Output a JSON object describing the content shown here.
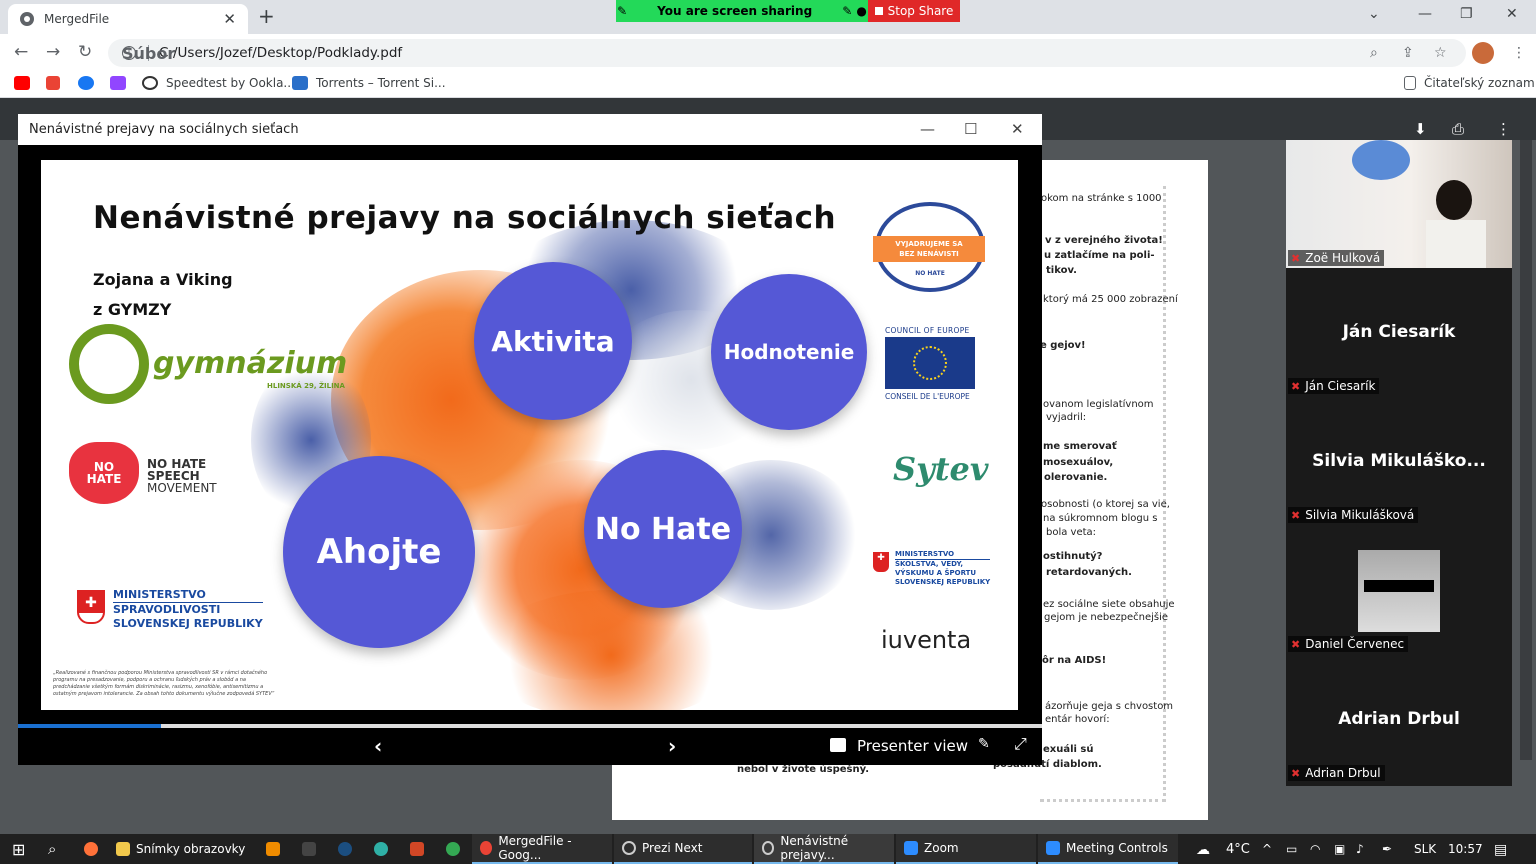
{
  "browser": {
    "tab_title": "MergedFile",
    "new_tab": "+",
    "address_prefix": "Súbor",
    "address": "C:/Users/Jozef/Desktop/Podklady.pdf",
    "bookmarks": [
      "Speedtest by Ookla...",
      "Torrents – Torrent Si..."
    ],
    "reading_list": "Čitateľský zoznam"
  },
  "screen_share": {
    "status": "You are screen sharing",
    "stop_label": "Stop Share"
  },
  "prezi": {
    "window_title": "Nenávistné prejavy na sociálnych sieťach",
    "slide": {
      "title": "Nenávistné prejavy na sociálnych sieťach",
      "authors_line1": "Zojana a Viking",
      "authors_line2": "z GYMZY",
      "school_name": "gymnázium",
      "school_addr": "HLINSKÁ 29, ŽILINA",
      "circles": [
        "Aktivita",
        "Hodnotenie",
        "Ahojte",
        "No Hate"
      ],
      "nohate_badge": "NO HATE",
      "nohate_movement": [
        "NO HATE",
        "SPEECH",
        "MOVEMENT"
      ],
      "vyjadrujeme": [
        "VYJADRUJEME SA",
        "BEZ NENÁVISTI",
        "NO HATE"
      ],
      "coe_top": "COUNCIL OF EUROPE",
      "coe_bottom": "CONSEIL DE L'EUROPE",
      "sytev": "Sytev",
      "min_justice": [
        "MINISTERSTVO",
        "SPRAVODLIVOSTI",
        "SLOVENSKEJ REPUBLIKY"
      ],
      "min_school": [
        "MINISTERSTVO",
        "ŠKOLSTVA, VEDY,",
        "VÝSKUMU A ŠPORTU",
        "SLOVENSKEJ REPUBLIKY"
      ],
      "iuventa": "iuventa",
      "footnote": "„Realizované s finančnou podporou Ministerstva spravodlivosti SR v rámci dotačného programu na presadzovanie, podporu a ochranu ľudských práv a slobôd a na predchádzanie všetkým formám diskriminácie, rasizmu, xenofóbie, antisemitizmu a ostatným prejavom intolerancie. Za obsah tohto dokumentu výlučne zodpovedá SYTEV“"
    },
    "progress": 0.14,
    "presenter_view": "Presenter view"
  },
  "pdf_text": [
    {
      "t": "okom na stránke s 1000",
      "b": false
    },
    {
      "t": "v z verejného života!",
      "b": true
    },
    {
      "t": "u zatlačíme na poli-",
      "b": true
    },
    {
      "t": "tikov.",
      "b": true
    },
    {
      "t": "ktorý má 25 000 zobrazení",
      "b": false
    },
    {
      "t": "e gejov!",
      "b": true
    },
    {
      "t": "ovanom legislatívnom",
      "b": false
    },
    {
      "t": "vyjadril:",
      "b": false
    },
    {
      "t": "me smerovať",
      "b": true
    },
    {
      "t": "mosexuálov,",
      "b": true
    },
    {
      "t": "olerovanie.",
      "b": true
    },
    {
      "t": "osobnosti (o ktorej sa vie,",
      "b": false
    },
    {
      "t": "na súkromnom blogu s",
      "b": false
    },
    {
      "t": "bola veta:",
      "b": false
    },
    {
      "t": "ostihnutý?",
      "b": true
    },
    {
      "t": "retardovaných.",
      "b": true
    },
    {
      "t": "ez sociálne siete obsahuje",
      "b": false
    },
    {
      "t": "gejom je nebezpečnejšie",
      "b": false
    },
    {
      "t": "ôr na AIDS!",
      "b": true
    },
    {
      "t": "ázorňuje geja s chvostom",
      "b": false
    },
    {
      "t": "entár hovorí:",
      "b": false
    },
    {
      "t": "exuáli sú",
      "b": true
    },
    {
      "t": "posadnutí diablom.",
      "b": true
    },
    {
      "t": "nebol v živote úspešný.",
      "b": true
    }
  ],
  "participants": [
    {
      "tile_name": "",
      "label": "Zoë Hulková",
      "video": true
    },
    {
      "tile_name": "Ján Ciesarík",
      "label": "Ján Ciesarík",
      "video": false
    },
    {
      "tile_name": "Silvia  Mikuláško...",
      "label": "Silvia Mikulášková",
      "video": false
    },
    {
      "tile_name": "",
      "label": "Daniel Červenec",
      "video": true
    },
    {
      "tile_name": "Adrian Drbul",
      "label": "Adrian Drbul",
      "video": false
    }
  ],
  "taskbar": {
    "apps": [
      "Snímky obrazovky",
      "MergedFile - Goog...",
      "Prezi Next",
      "Nenávistné prejavy...",
      "Zoom",
      "Meeting Controls"
    ],
    "temp": "4°C",
    "lang": "SLK",
    "time": "10:57"
  }
}
